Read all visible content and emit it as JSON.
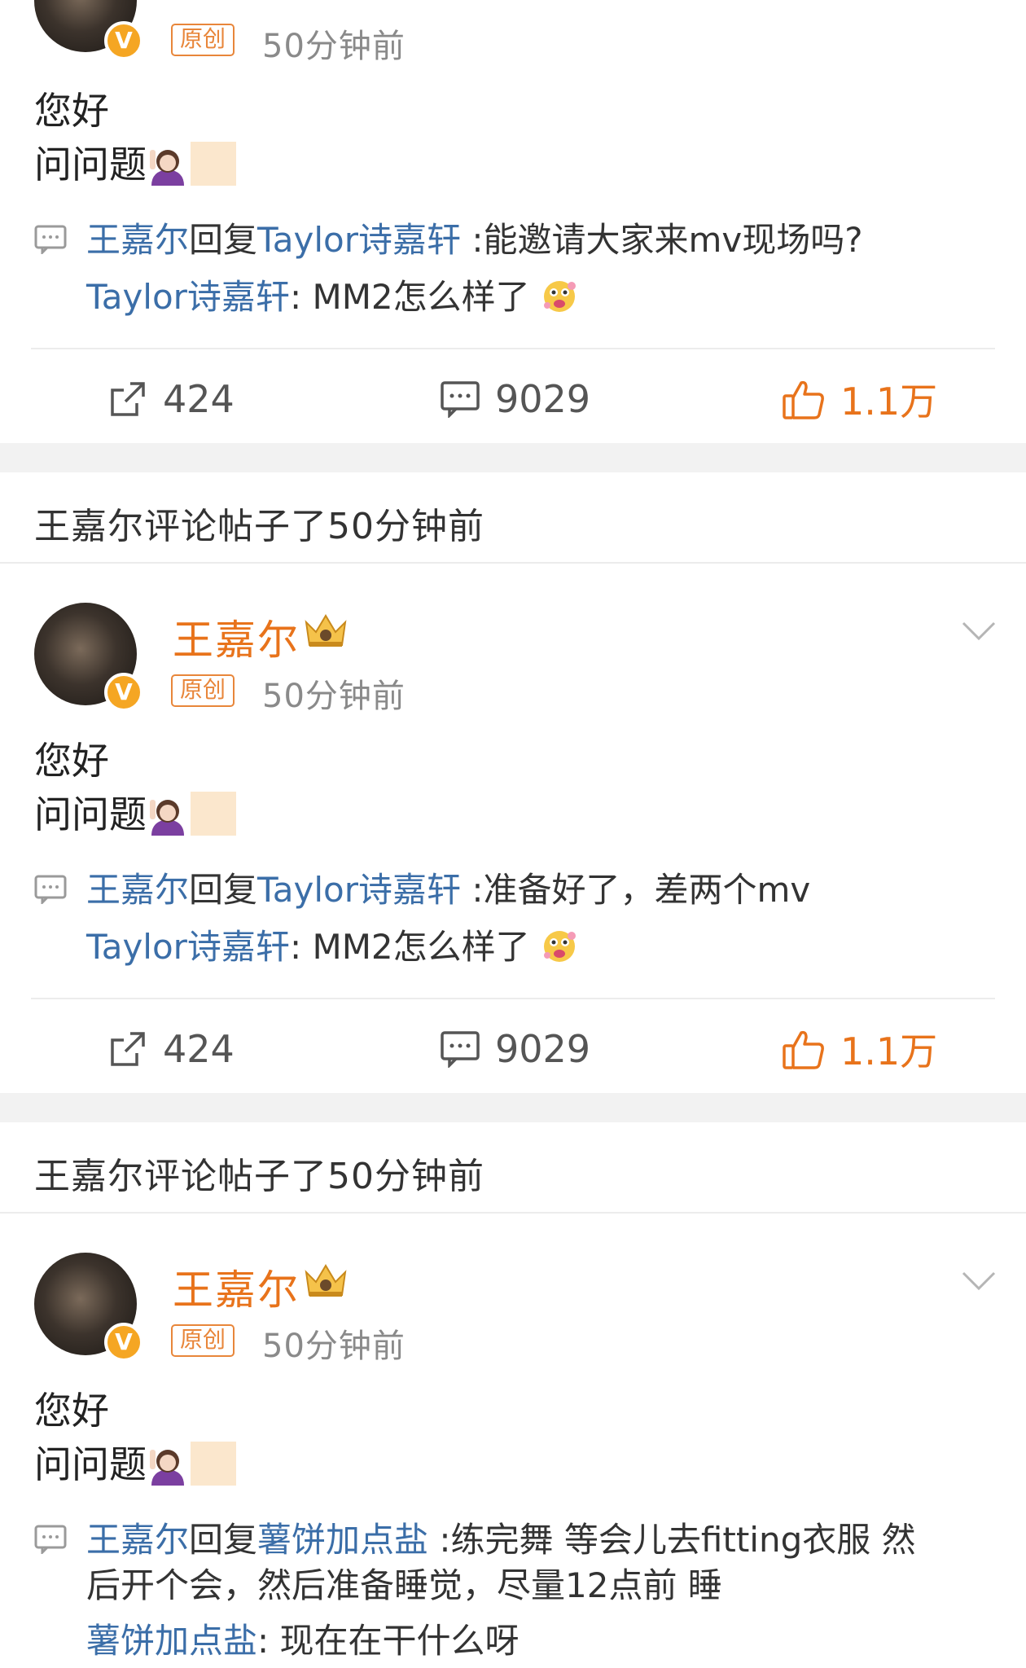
{
  "colors": {
    "accent": "#e8731b",
    "link": "#3b6ea8",
    "badge": "#e8863a",
    "verified": "#f5a623"
  },
  "posts": [
    {
      "author": "",
      "badge": "原创",
      "time": "50分钟前",
      "line1": "您好",
      "line2": "问问题",
      "reply": {
        "from": "王嘉尔",
        "verb": "回复",
        "to": "Taylor诗嘉轩",
        "text": ":能邀请大家来mv现场吗?"
      },
      "quote": {
        "user": "Taylor诗嘉轩",
        "sep": ":",
        "text": "MM2怎么样了"
      },
      "actions": {
        "repost": "424",
        "comments": "9029",
        "likes": "1.1万"
      }
    },
    {
      "author": "王嘉尔",
      "badge": "原创",
      "time": "50分钟前",
      "line1": "您好",
      "line2": "问问题",
      "reply": {
        "from": "王嘉尔",
        "verb": "回复",
        "to": "Taylor诗嘉轩",
        "text": ":准备好了，差两个mv"
      },
      "quote": {
        "user": "Taylor诗嘉轩",
        "sep": ":",
        "text": "MM2怎么样了"
      },
      "actions": {
        "repost": "424",
        "comments": "9029",
        "likes": "1.1万"
      }
    },
    {
      "author": "王嘉尔",
      "badge": "原创",
      "time": "50分钟前",
      "line1": "您好",
      "line2": "问问题",
      "reply": {
        "from": "王嘉尔",
        "verb": "回复",
        "to": "薯饼加点盐",
        "text": ":练完舞 等会儿去fitting衣服 然",
        "text2": "后开个会，然后准备睡觉，尽量12点前 睡"
      },
      "quote": {
        "user": "薯饼加点盐",
        "sep": ":",
        "text": "现在在干什么呀"
      }
    }
  ],
  "notices": [
    {
      "text": "王嘉尔评论帖子了50分钟前"
    },
    {
      "text": "王嘉尔评论帖子了50分钟前"
    }
  ],
  "icons": [
    "verified-badge-icon",
    "crown-icon",
    "chevron-down-icon",
    "reply-comment-icon",
    "repost-icon",
    "comment-icon",
    "like-icon",
    "emoji-face-icon",
    "emoji-person-icon"
  ]
}
